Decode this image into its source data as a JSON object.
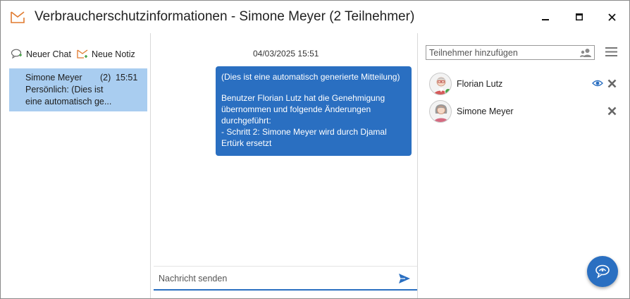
{
  "window": {
    "title": "Verbraucherschutzinformationen - Simone Meyer (2 Teilnehmer)",
    "icon": "envelope-icon",
    "controls": [
      "minimize",
      "maximize",
      "close"
    ]
  },
  "left_panel": {
    "actions": [
      {
        "label": "Neuer Chat",
        "icon": "new-chat-icon"
      },
      {
        "label": "Neue Notiz",
        "icon": "new-note-icon"
      }
    ],
    "chats": [
      {
        "name": "Simone Meyer",
        "count": "(2)",
        "time": "15:51",
        "preview": "Persönlich: (Dies ist\neine automatisch ge...",
        "selected": true
      }
    ]
  },
  "conversation": {
    "messages": [
      {
        "date": "04/03/2025 15:51",
        "paragraph1": "(Dies ist eine automatisch generierte Mitteilung)",
        "paragraph2": "Benutzer Florian Lutz hat die Genehmigung\nübernommen und folgende Änderungen\ndurchgeführt:\n - Schritt 2: Simone Meyer wird durch Djamal\nErtürk ersetzt"
      }
    ],
    "compose": {
      "placeholder": "Nachricht senden",
      "value": ""
    }
  },
  "participants_panel": {
    "search_placeholder": "Teilnehmer hinzufügen",
    "participants": [
      {
        "name": "Florian Lutz",
        "observer": true,
        "removable": true
      },
      {
        "name": "Simone Meyer",
        "observer": false,
        "removable": true
      }
    ]
  },
  "colors": {
    "accent": "#2a6fc1",
    "selected_chat": "#a9cdf0",
    "title_icon": "#e07a2f"
  }
}
